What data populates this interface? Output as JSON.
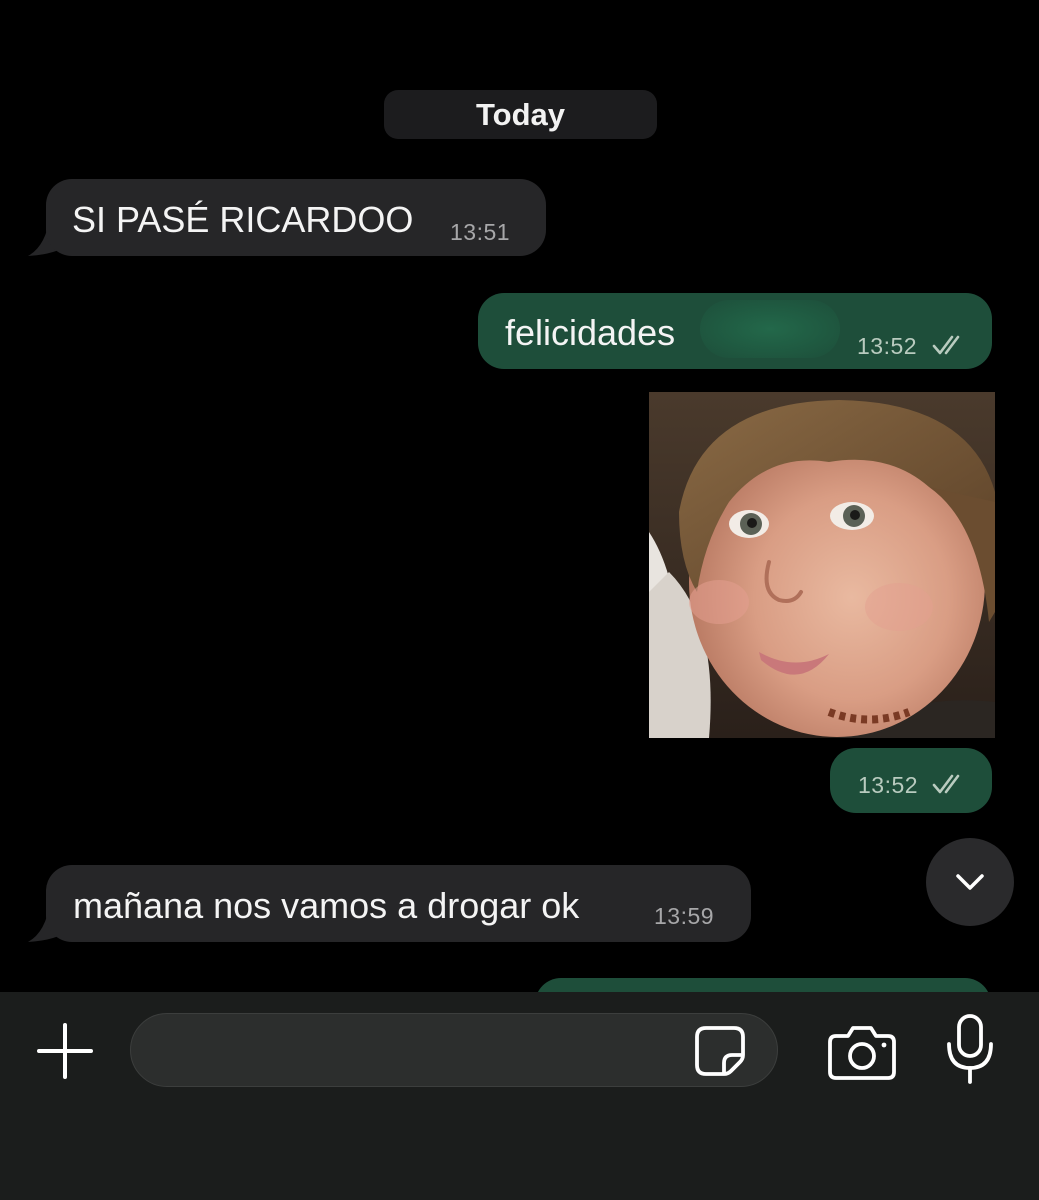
{
  "date_separator": "Today",
  "messages": [
    {
      "direction": "incoming",
      "text": "SI PASÉ RICARDOO",
      "time": "13:51"
    },
    {
      "direction": "outgoing",
      "text": "felicidades",
      "time": "13:52",
      "status": "read"
    },
    {
      "direction": "outgoing",
      "type": "image",
      "image_icon": "photo-of-smiling-child",
      "time": "13:52",
      "status": "read"
    },
    {
      "direction": "incoming",
      "text": "mañana nos vamos a drogar ok",
      "time": "13:59"
    }
  ],
  "composer": {
    "placeholder": "",
    "value": "",
    "icons": {
      "attach": "plus-icon",
      "sticker": "sticker-icon",
      "camera": "camera-icon",
      "microphone": "microphone-icon"
    }
  },
  "scroll_button_icon": "chevron-down-icon",
  "colors": {
    "background": "#000000",
    "incoming_bubble": "#262628",
    "outgoing_bubble": "#1e4e3a",
    "read_ticks": "#b9cbbf"
  }
}
